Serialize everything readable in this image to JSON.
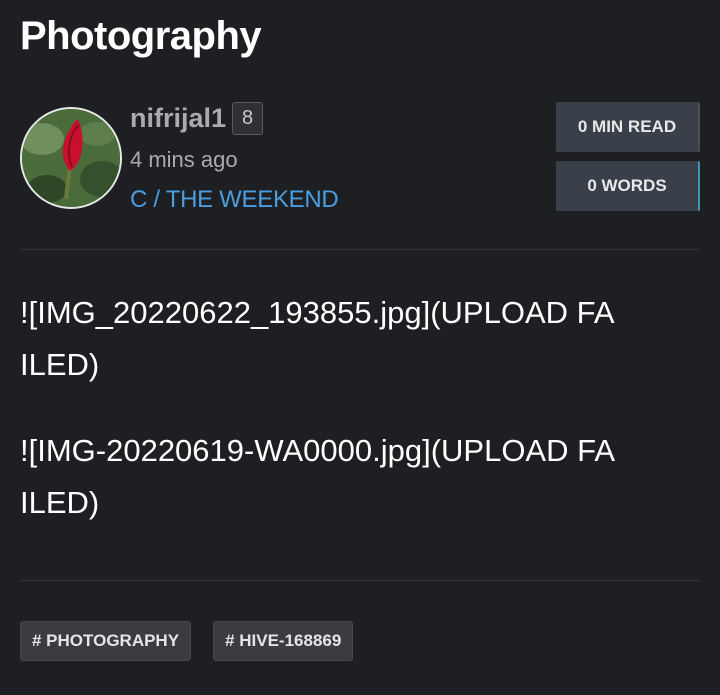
{
  "post": {
    "title": "Photography",
    "author": {
      "name": "nifrijal1",
      "reputation": "8",
      "avatar_icon": "avatar-photo"
    },
    "timestamp": "4 mins ago",
    "community": "C / THE WEEKEND",
    "stats": {
      "read_time": "0 MIN READ",
      "words": "0 WORDS"
    },
    "body": [
      "![IMG_20220622_193855.jpg](UPLOAD FAILED)",
      "![IMG-20220619-WA0000.jpg](UPLOAD FAILED)"
    ],
    "tags": [
      "# PHOTOGRAPHY",
      "# HIVE-168869"
    ]
  },
  "colors": {
    "background": "#1e1f22",
    "community_link": "#4a9de0",
    "stat_box": "#3a4049",
    "words_accent": "#3b98b3"
  }
}
